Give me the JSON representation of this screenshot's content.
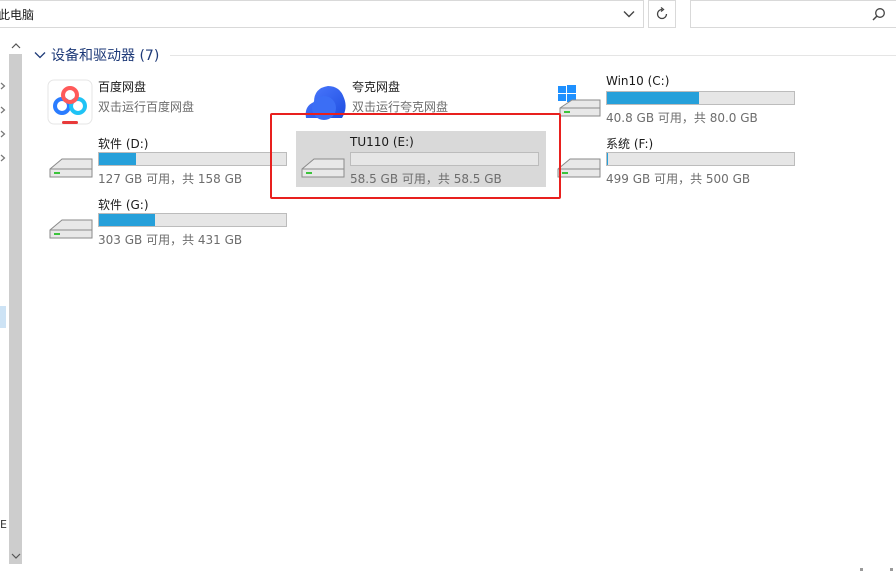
{
  "address": {
    "path": "此电脑"
  },
  "search": {
    "placeholder": ""
  },
  "group": {
    "title": "设备和驱动器 (7)"
  },
  "apps": [
    {
      "name": "百度网盘",
      "subtitle": "双击运行百度网盘",
      "icon": "baidu-netdisk-icon"
    },
    {
      "name": "夸克网盘",
      "subtitle": "双击运行夸克网盘",
      "icon": "quark-netdisk-icon"
    }
  ],
  "drives": [
    {
      "name": "Win10 (C:)",
      "space": "40.8 GB 可用，共 80.0 GB",
      "used_fraction": 0.49,
      "icon": "windows-drive-icon"
    },
    {
      "name": "软件 (D:)",
      "space": "127 GB 可用，共 158 GB",
      "used_fraction": 0.2,
      "icon": "hard-drive-icon"
    },
    {
      "name": "TU110 (E:)",
      "space": "58.5 GB 可用，共 58.5 GB",
      "used_fraction": 0.0,
      "icon": "hard-drive-icon"
    },
    {
      "name": "系统 (F:)",
      "space": "499 GB 可用，共 500 GB",
      "used_fraction": 0.002,
      "icon": "hard-drive-icon"
    },
    {
      "name": "软件 (G:)",
      "space": "303 GB 可用，共 431 GB",
      "used_fraction": 0.3,
      "icon": "hard-drive-icon"
    }
  ],
  "nav": {
    "letter": "E"
  },
  "colors": {
    "accent": "#26a0da",
    "highlight": "#e8201e",
    "header": "#1e3a78",
    "selected": "#d9d9d9"
  }
}
